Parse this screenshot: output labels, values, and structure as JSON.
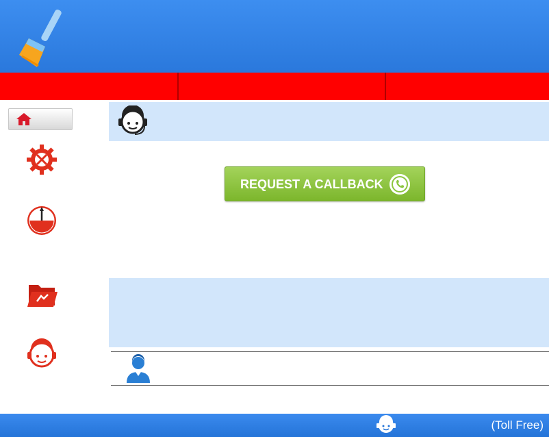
{
  "header": {
    "logo_icon": "broom-icon",
    "tabs": [
      "",
      "",
      ""
    ]
  },
  "sidebar": {
    "items": [
      {
        "icon": "home-icon"
      },
      {
        "icon": "gear-tools-icon"
      },
      {
        "icon": "speedometer-icon"
      },
      {
        "icon": "folder-icon"
      },
      {
        "icon": "support-agent-icon"
      }
    ]
  },
  "main": {
    "header_icon": "support-agent-icon",
    "callback_button": {
      "label": "REQUEST A CALLBACK",
      "icon": "phone-icon"
    },
    "user_icon": "user-icon"
  },
  "footer": {
    "icon": "support-agent-icon",
    "toll_free_label": "(Toll Free)"
  },
  "colors": {
    "header_blue": "#2a78dc",
    "nav_red": "#ff0000",
    "panel_blue": "#d2e6fb",
    "icon_red": "#e0301e",
    "button_green": "#8cc63f"
  }
}
